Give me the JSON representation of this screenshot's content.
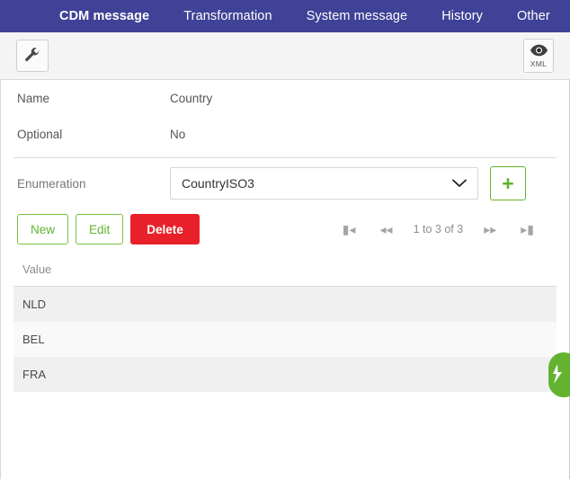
{
  "navbar": {
    "items": [
      {
        "label": "CDM message",
        "active": true
      },
      {
        "label": "Transformation",
        "active": false
      },
      {
        "label": "System message",
        "active": false
      },
      {
        "label": "History",
        "active": false
      },
      {
        "label": "Other",
        "active": false
      }
    ],
    "background_color": "#3f4296"
  },
  "toolbar": {
    "settings_icon": "wrench-icon",
    "xml_icon": "eye-icon",
    "xml_label": "XML"
  },
  "properties": [
    {
      "label": "Name",
      "value": "Country"
    },
    {
      "label": "Optional",
      "value": "No"
    }
  ],
  "enumeration": {
    "label": "Enumeration",
    "selected": "CountryISO3",
    "chevron_icon": "chevron-down-icon",
    "add_button_icon": "plus-icon",
    "accent_color": "#62b32e"
  },
  "actions": {
    "new_label": "New",
    "edit_label": "Edit",
    "delete_label": "Delete",
    "delete_color": "#e8202a",
    "outline_color": "#7ac142"
  },
  "pagination": {
    "first_icon": "page-first-icon",
    "prev_icon": "page-prev-icon",
    "status": "1 to 3 of 3",
    "next_icon": "page-next-icon",
    "last_icon": "page-last-icon"
  },
  "table": {
    "columns": [
      "Value"
    ],
    "rows": [
      {
        "value": "NLD"
      },
      {
        "value": "BEL"
      },
      {
        "value": "FRA"
      }
    ]
  },
  "float_tab": {
    "icon": "feedback-icon",
    "color": "#63b331"
  }
}
